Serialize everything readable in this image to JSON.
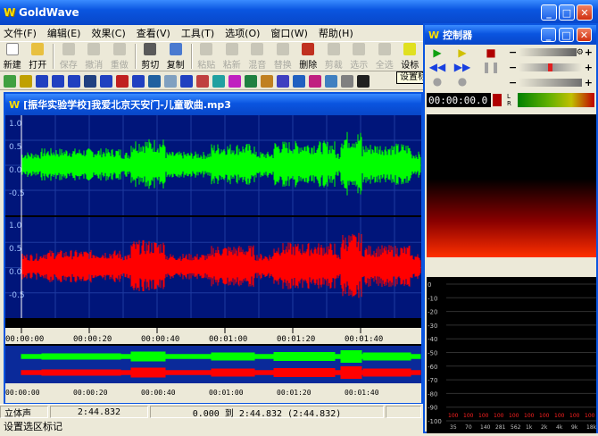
{
  "app": {
    "title": "GoldWave",
    "icon": "W"
  },
  "menu": [
    "文件(F)",
    "编辑(E)",
    "效果(C)",
    "查看(V)",
    "工具(T)",
    "选项(O)",
    "窗口(W)",
    "帮助(H)"
  ],
  "toolbar": [
    {
      "label": "新建",
      "enabled": true,
      "color": "#ffffff"
    },
    {
      "label": "打开",
      "enabled": true,
      "color": "#e8c040"
    },
    {
      "label": "保存",
      "enabled": false
    },
    {
      "label": "撤消",
      "enabled": false
    },
    {
      "label": "重做",
      "enabled": false
    },
    {
      "label": "剪切",
      "enabled": true,
      "color": "#5a5a5a"
    },
    {
      "label": "复制",
      "enabled": true,
      "color": "#4a7ad0"
    },
    {
      "label": "粘贴",
      "enabled": false
    },
    {
      "label": "粘新",
      "enabled": false
    },
    {
      "label": "混音",
      "enabled": false
    },
    {
      "label": "替换",
      "enabled": false
    },
    {
      "label": "删除",
      "enabled": true,
      "color": "#c03020"
    },
    {
      "label": "剪裁",
      "enabled": false
    },
    {
      "label": "选示",
      "enabled": false
    },
    {
      "label": "全选",
      "enabled": false
    },
    {
      "label": "设标",
      "enabled": true,
      "color": "#e0e020"
    }
  ],
  "tooltip": "设置标记 (Shift+E)",
  "document": {
    "title": "[振华实验学校]我爱北京天安门-儿童歌曲.mp3",
    "y_labels_top": [
      "1.0",
      "0.5",
      "0.0",
      "-0.5"
    ],
    "y_labels_bottom": [
      "1.0",
      "0.5",
      "0.0",
      "-0.5"
    ],
    "timeline": [
      "00:00:00",
      "00:00:20",
      "00:00:40",
      "00:01:00",
      "00:01:20",
      "00:01:40"
    ],
    "left_channel_color": "#00ff00",
    "right_channel_color": "#ff0000",
    "wave_bg": "#00157a"
  },
  "status": {
    "channels": "立体声",
    "length": "2:44.832",
    "selection": "0.000 到 2:44.832 (2:44.832)"
  },
  "hint": "设置选区标记",
  "control": {
    "title": "控制器",
    "time": "00:00:00.0",
    "spectrum_y": [
      "0",
      "-10",
      "-20",
      "-30",
      "-40",
      "-50",
      "-60",
      "-70",
      "-80",
      "-90",
      "-100"
    ],
    "spectrum_x": [
      "35",
      "70",
      "140",
      "281",
      "562",
      "1k",
      "2k",
      "4k",
      "9k",
      "18k"
    ],
    "peak_label": "100"
  }
}
